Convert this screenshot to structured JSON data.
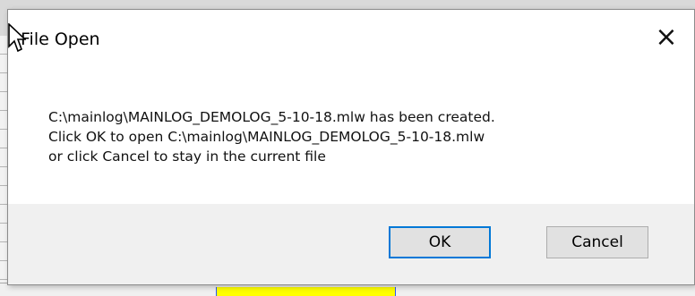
{
  "dialog": {
    "title": "File Open",
    "message_lines": [
      "C:\\mainlog\\MAINLOG_DEMOLOG_5-10-18.mlw  has been created.",
      "Click OK to open C:\\mainlog\\MAINLOG_DEMOLOG_5-10-18.mlw",
      "or click Cancel to stay in the current file"
    ],
    "buttons": {
      "ok": "OK",
      "cancel": "Cancel"
    },
    "close_symbol": "×"
  },
  "icons": {
    "close": "close-icon",
    "cursor": "mouse-pointer-icon"
  },
  "colors": {
    "dialog_bg": "#ffffff",
    "footer_bg": "#f0f0f0",
    "button_bg": "#e1e1e1",
    "button_border": "#adadad",
    "default_button_border": "#0078d7",
    "background_grid": "#f2f2f2",
    "background_blue": "#2b57ff",
    "background_yellow": "#ffff00"
  }
}
